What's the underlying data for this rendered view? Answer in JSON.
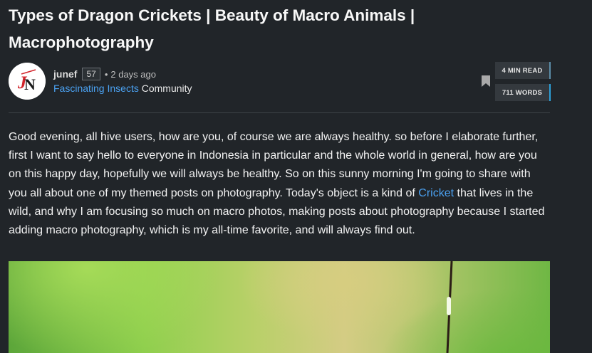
{
  "post": {
    "title": "Types of Dragon Crickets | Beauty of Macro Animals | Macrophotography"
  },
  "author": {
    "avatar_initials": "JN",
    "username": "junef",
    "reputation": "57",
    "separator": "•",
    "posted": "2 days ago",
    "community_link": "Fascinating Insects",
    "community_suffix": "Community"
  },
  "stats": {
    "read_time": "4 MIN READ",
    "word_count": "711 WORDS"
  },
  "body": {
    "part1": "Good evening, all hive users, how are you, of course we are always healthy. so before I elaborate further, first I want to say hello to everyone in Indonesia in particular and the whole world in general, how are you on this happy day, hopefully we will always be healthy. So on this sunny morning I'm going to share with you all about one of my themed posts on photography. Today's object is a kind of ",
    "link": "Cricket",
    "part2": " that lives in the wild, and why I am focusing so much on macro photos, making posts about photography because I started adding macro photography, which is my all-time favorite, and will always find out."
  },
  "colors": {
    "background": "#212529",
    "link": "#4ba2f2",
    "avatar_accent": "#d2232a"
  },
  "icons": {
    "bookmark": "bookmark-icon"
  }
}
